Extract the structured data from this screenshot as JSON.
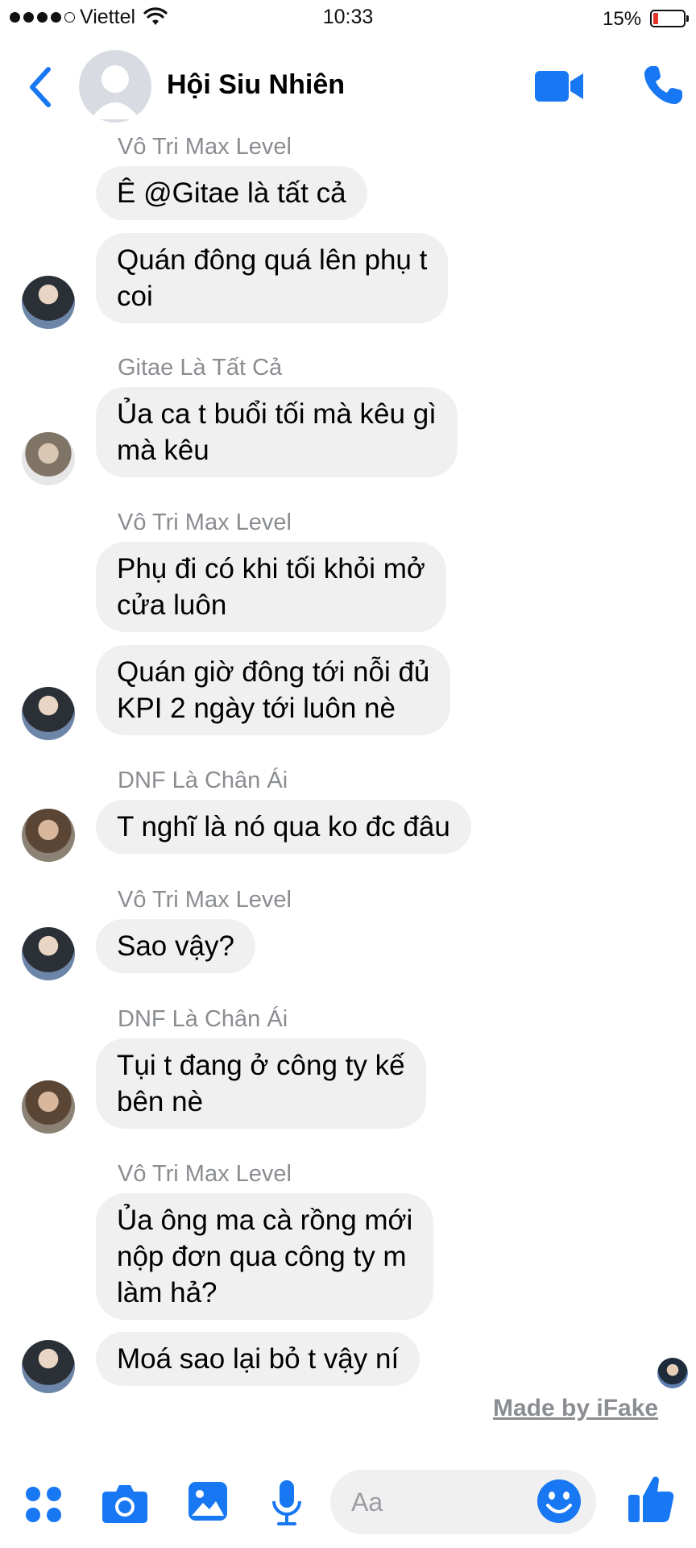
{
  "status_bar": {
    "carrier": "Viettel",
    "time": "10:33",
    "battery_percent": "15%",
    "signal_bars_filled": 4,
    "signal_bars_total": 5
  },
  "header": {
    "title": "Hội Siu Nhiên",
    "back_icon": "chevron-left-icon",
    "video_icon": "video-camera-icon",
    "call_icon": "phone-icon"
  },
  "messages": [
    {
      "sender": "Vô Tri Max Level",
      "bubbles": [
        "Ê @Gitae là tất cả",
        [
          "Quán đông quá lên phụ t",
          "coi"
        ]
      ]
    },
    {
      "sender": "Gitae Là Tất Cả",
      "bubbles": [
        [
          "Ủa ca t buổi tối mà kêu gì",
          "mà kêu"
        ]
      ]
    },
    {
      "sender": "Vô Tri Max Level",
      "bubbles": [
        [
          "Phụ đi có khi tối khỏi mở",
          "cửa luôn"
        ],
        [
          "Quán giờ đông tới nỗi đủ",
          "KPI 2 ngày tới luôn nè"
        ]
      ]
    },
    {
      "sender": "DNF Là Chân Ái",
      "bubbles": [
        "T nghĩ là nó qua ko đc đâu"
      ]
    },
    {
      "sender": "Vô Tri Max Level",
      "bubbles": [
        "Sao vậy?"
      ]
    },
    {
      "sender": "DNF Là Chân Ái",
      "bubbles": [
        [
          "Tụi t đang ở công ty kế",
          "bên nè"
        ]
      ]
    },
    {
      "sender": "Vô Tri Max Level",
      "bubbles": [
        [
          "Ủa ông ma cà rồng mới",
          "nộp đơn qua công ty m",
          "làm hả?"
        ],
        "Moá sao lại bỏ t vậy ní"
      ]
    }
  ],
  "watermark": "Made by iFake",
  "composer": {
    "placeholder": "Aa",
    "icons": [
      "apps-icon",
      "camera-icon",
      "image-icon",
      "microphone-icon",
      "emoji-icon",
      "thumbs-up-icon"
    ]
  },
  "colors": {
    "accent": "#1877f2",
    "bubble": "#f0f0f0",
    "sender_text": "#8a8d91",
    "battery_low": "#e0352b"
  }
}
